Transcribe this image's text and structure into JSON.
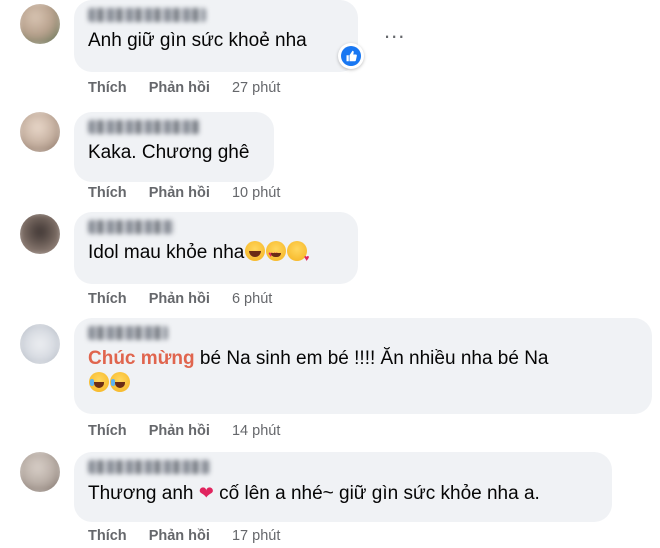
{
  "comments": [
    {
      "text": "Anh giữ gìn sức khoẻ nha",
      "actions": {
        "like": "Thích",
        "reply": "Phản hồi",
        "time": "27 phút"
      },
      "reaction": "like-icon",
      "avatar_colors": [
        "#b7a08c",
        "#6c7a5d"
      ]
    },
    {
      "text": "Kaka. Chương ghê",
      "actions": {
        "like": "Thích",
        "reply": "Phản hồi",
        "time": "10 phút"
      },
      "avatar_colors": [
        "#c7b2a2",
        "#8a7466"
      ]
    },
    {
      "text": "Idol mau khỏe nha",
      "emojis": [
        "laughing-tears-emoji",
        "heart-eyes-emoji",
        "kissing-heart-emoji"
      ],
      "actions": {
        "like": "Thích",
        "reply": "Phản hồi",
        "time": "6 phút"
      },
      "avatar_colors": [
        "#3d3432",
        "#a8968c"
      ]
    },
    {
      "text_highlight": "Chúc mừng",
      "text": " bé Na sinh em bé !!!! Ăn nhiều nha bé Na",
      "emojis": [
        "crying-laughing-emoji",
        "crying-laughing-emoji"
      ],
      "actions": {
        "like": "Thích",
        "reply": "Phản hồi",
        "time": "14 phút"
      },
      "avatar_colors": [
        "#d5d9e0",
        "#aab1bb"
      ]
    },
    {
      "text_before": "Thương anh ",
      "text_after": " cố lên a nhé~ giữ gìn sức khỏe nha a.",
      "heart": "❤",
      "actions": {
        "like": "Thích",
        "reply": "Phản hồi",
        "time": "17 phút"
      },
      "avatar_colors": [
        "#b9aea6",
        "#7f726b"
      ]
    }
  ],
  "more_menu": "...",
  "colors": {
    "bubble": "#f0f2f5",
    "meta": "#65676b",
    "highlight": "#e0654e",
    "like": "#1877f2"
  }
}
